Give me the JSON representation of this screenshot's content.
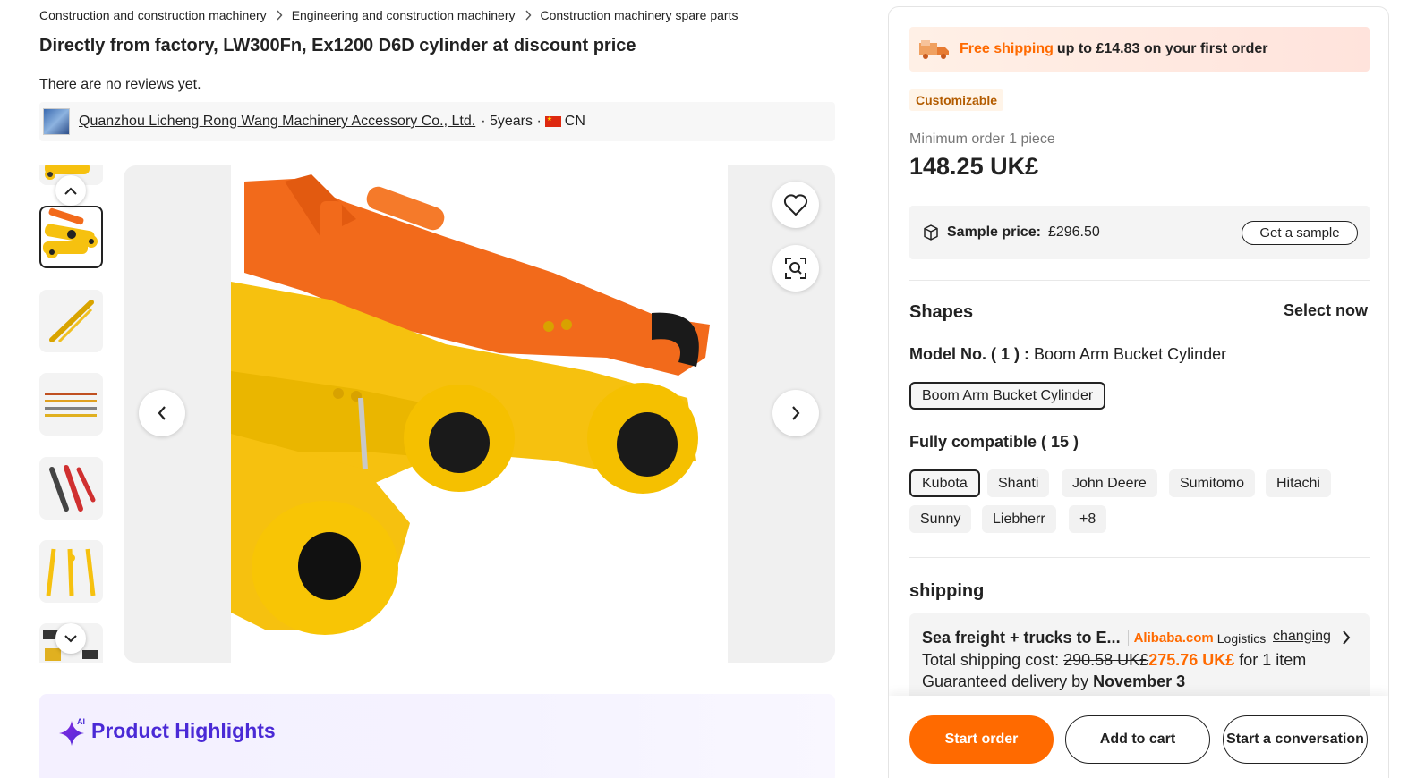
{
  "breadcrumb": [
    "Construction and construction machinery",
    "Engineering and construction machinery",
    "Construction machinery spare parts"
  ],
  "product": {
    "title": "Directly from factory, LW300Fn, Ex1200 D6D cylinder at discount price",
    "reviews": "There are no reviews yet."
  },
  "supplier": {
    "name": "Quanzhou Licheng Rong Wang Machinery Accessory Co., Ltd.",
    "years": "· 5years ·",
    "country": "CN"
  },
  "highlights": {
    "ai_label": "AI",
    "title": "Product Highlights"
  },
  "promo": {
    "free_shipping": "Free shipping",
    "rest": "up to £14.83 on your first order"
  },
  "badge": "Customizable",
  "pricing": {
    "min_order": "Minimum order 1 piece",
    "price": "148.25 UK£",
    "sample_label": "Sample price:",
    "sample_value": "£296.50",
    "sample_button": "Get a sample"
  },
  "shapes": {
    "title": "Shapes",
    "select_now": "Select now",
    "model_label": "Model No. ( 1 ) :",
    "model_value": "Boom Arm Bucket Cylinder",
    "model_options": [
      "Boom Arm Bucket Cylinder"
    ]
  },
  "compat": {
    "title": "Fully compatible ( 15 )",
    "options": [
      "Kubota",
      "Shanti",
      "John Deere",
      "Sumitomo",
      "Hitachi",
      "Sunny",
      "Liebherr",
      "+8"
    ]
  },
  "shipping": {
    "title": "shipping",
    "method": "Sea freight + trucks to E...",
    "provider": "Alibaba.com",
    "provider_suffix": "Logistics",
    "change": "changing",
    "cost_label": "Total shipping cost:",
    "old_cost": "290.58 UK£",
    "new_cost": "275.76 UK£",
    "cost_suffix": "for 1 item",
    "delivery_label": "Guaranteed delivery by",
    "delivery_date": "November 3"
  },
  "actions": {
    "start_order": "Start order",
    "add_to_cart": "Add to cart",
    "conversation": "Start a conversation"
  },
  "colors": {
    "accent": "#ff6a00",
    "ai_purple": "#4a2ad6",
    "cylinder_yellow": "#f6c10f",
    "cylinder_orange": "#f26a1b"
  }
}
